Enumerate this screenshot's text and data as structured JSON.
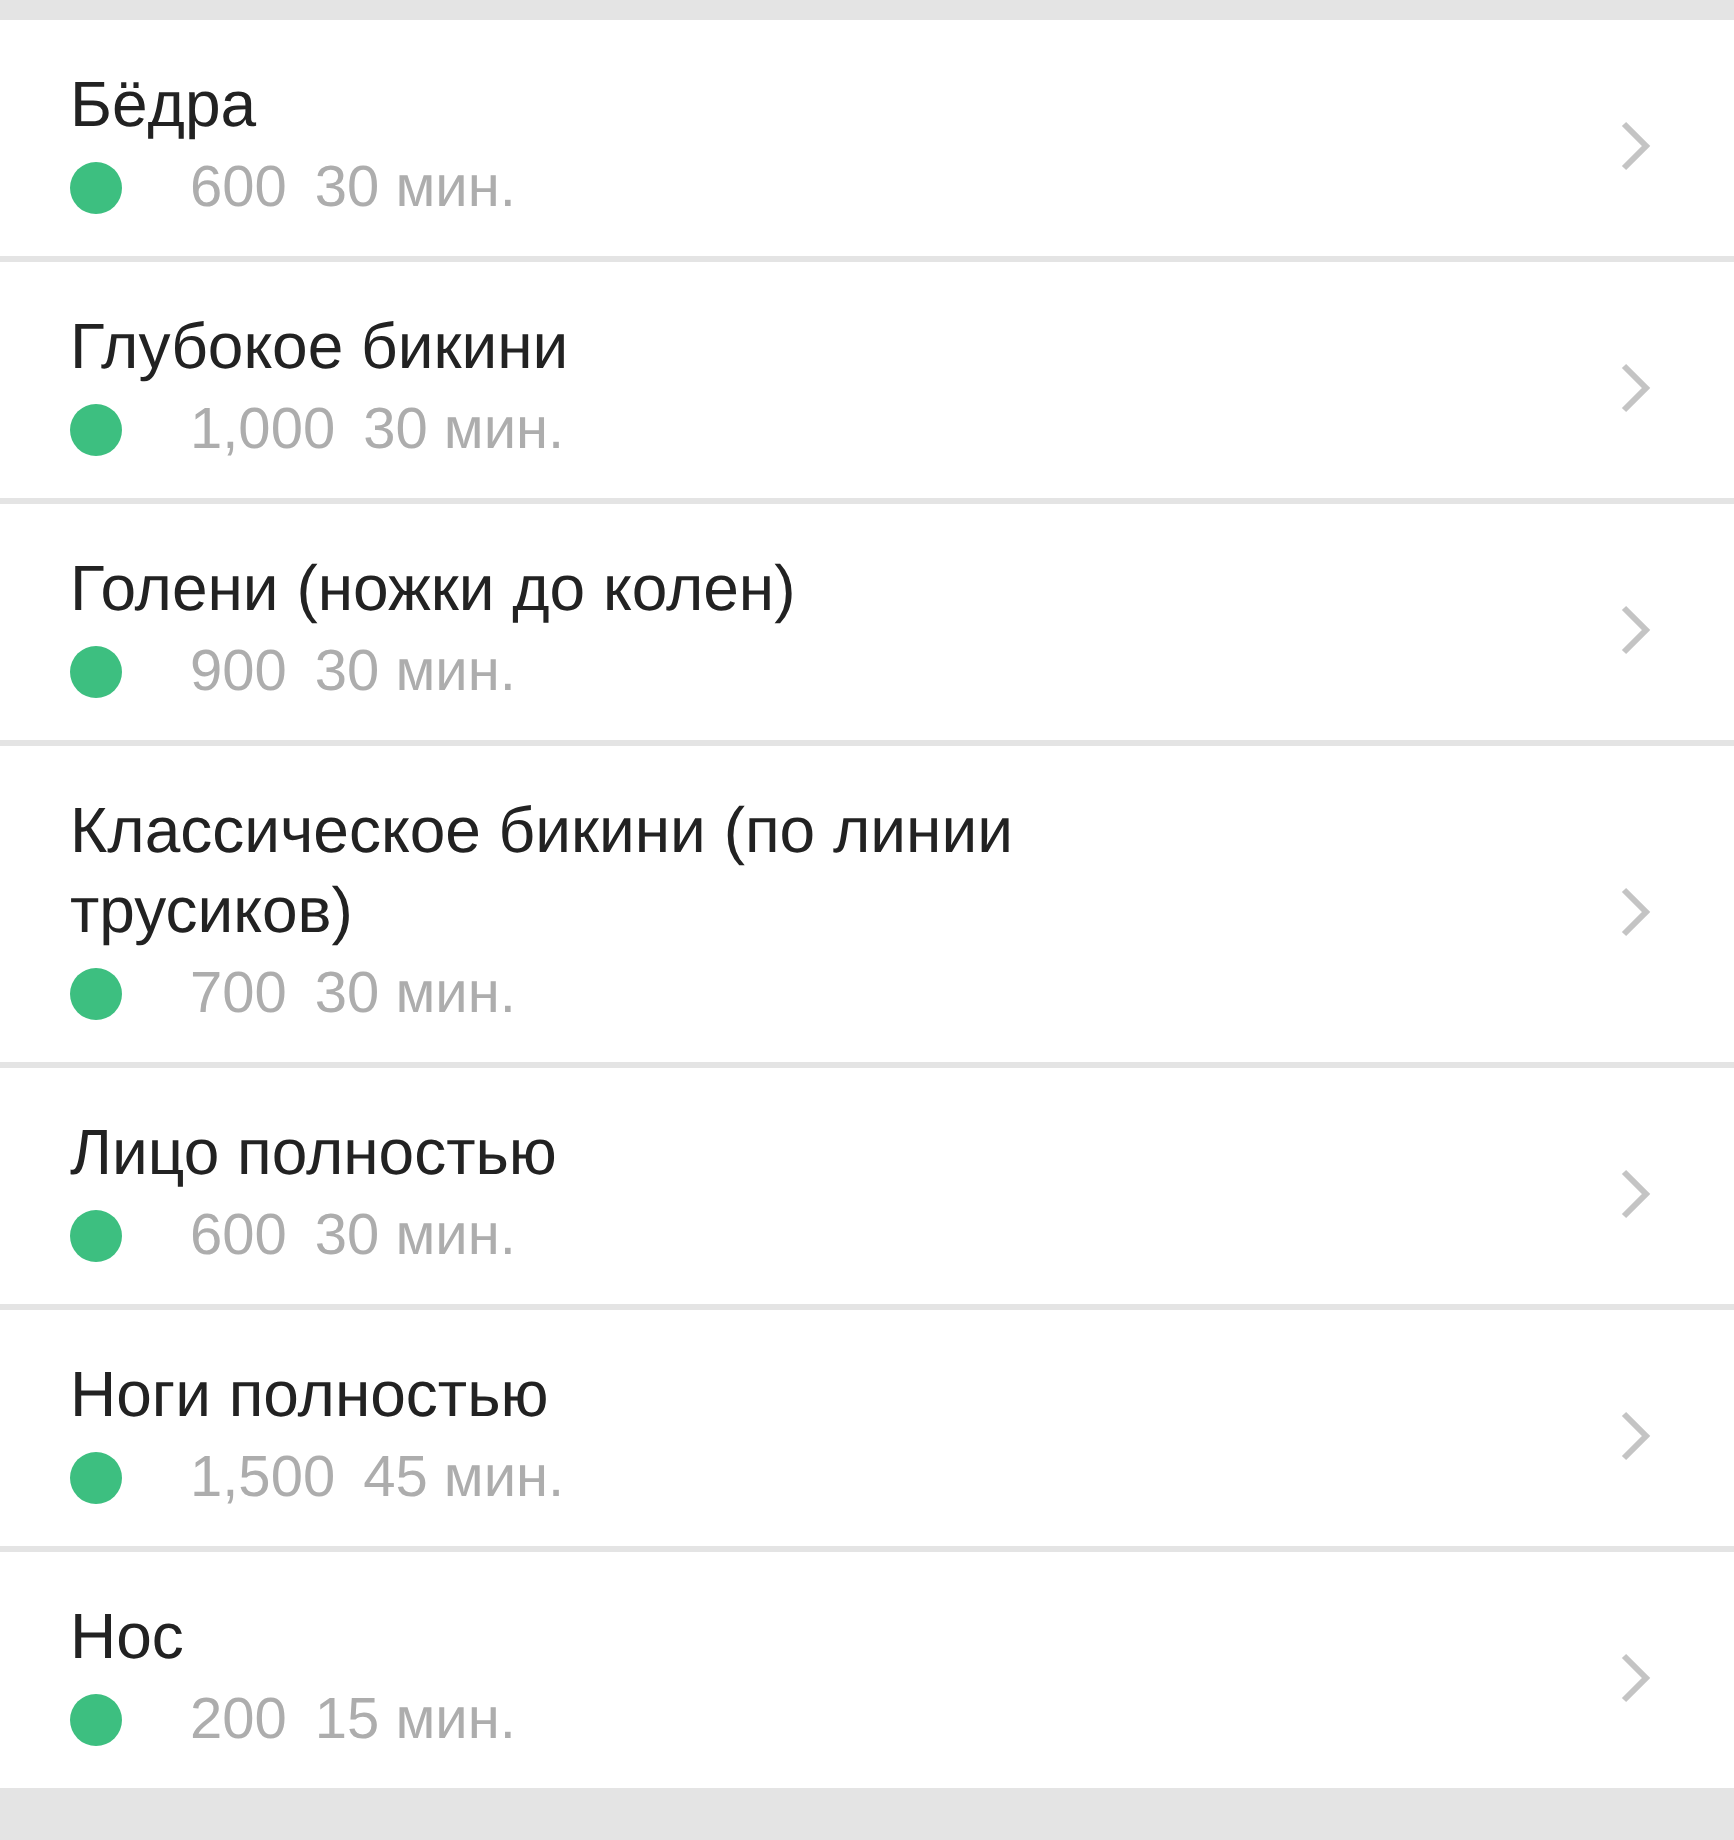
{
  "services": [
    {
      "name": "Бёдра",
      "price": "600",
      "duration": "30 мин.",
      "color": "#3dbf80"
    },
    {
      "name": "Глубокое бикини",
      "price": "1,000",
      "duration": "30 мин.",
      "color": "#3dbf80"
    },
    {
      "name": "Голени (ножки до колен)",
      "price": "900",
      "duration": "30 мин.",
      "color": "#3dbf80"
    },
    {
      "name": "Классическое бикини (по линии трусиков)",
      "price": "700",
      "duration": "30 мин.",
      "color": "#3dbf80"
    },
    {
      "name": "Лицо полностью",
      "price": "600",
      "duration": "30 мин.",
      "color": "#3dbf80"
    },
    {
      "name": "Ноги полностью",
      "price": "1,500",
      "duration": "45 мин.",
      "color": "#3dbf80"
    },
    {
      "name": "Нос",
      "price": "200",
      "duration": "15 мин.",
      "color": "#3dbf80"
    }
  ]
}
